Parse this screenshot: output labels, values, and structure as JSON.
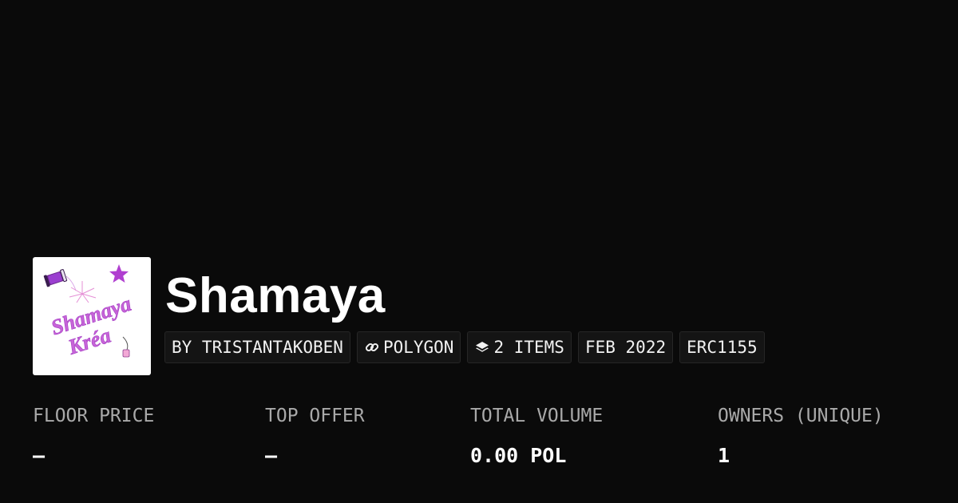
{
  "collection": {
    "name": "Shamaya",
    "logo": {
      "line1": "Shamaya",
      "line2": "Kréa",
      "text_color": "#c764d8",
      "accent_color": "#b03fd0",
      "sparkle_icon": "sparkle-star-icon",
      "spool_icon": "spool-icon",
      "tag_icon": "tag-charm-icon"
    }
  },
  "chips": {
    "creator": "BY TRISTANTAKOBEN",
    "chain": {
      "label": "POLYGON",
      "icon": "link-icon"
    },
    "items": {
      "label": "2 ITEMS",
      "icon": "layers-icon"
    },
    "date": "FEB 2022",
    "standard": "ERC1155"
  },
  "stats": {
    "floor_price": {
      "label": "FLOOR PRICE",
      "value": "—"
    },
    "top_offer": {
      "label": "TOP OFFER",
      "value": "—"
    },
    "total_volume": {
      "label": "TOTAL VOLUME",
      "value": "0.00 POL"
    },
    "owners": {
      "label": "OWNERS (UNIQUE)",
      "value": "1"
    }
  },
  "colors": {
    "background": "#0a0a0a",
    "chip_background": "#141414",
    "chip_border": "#262626",
    "label_gray": "#a9a9a9",
    "text_white": "#ffffff"
  }
}
